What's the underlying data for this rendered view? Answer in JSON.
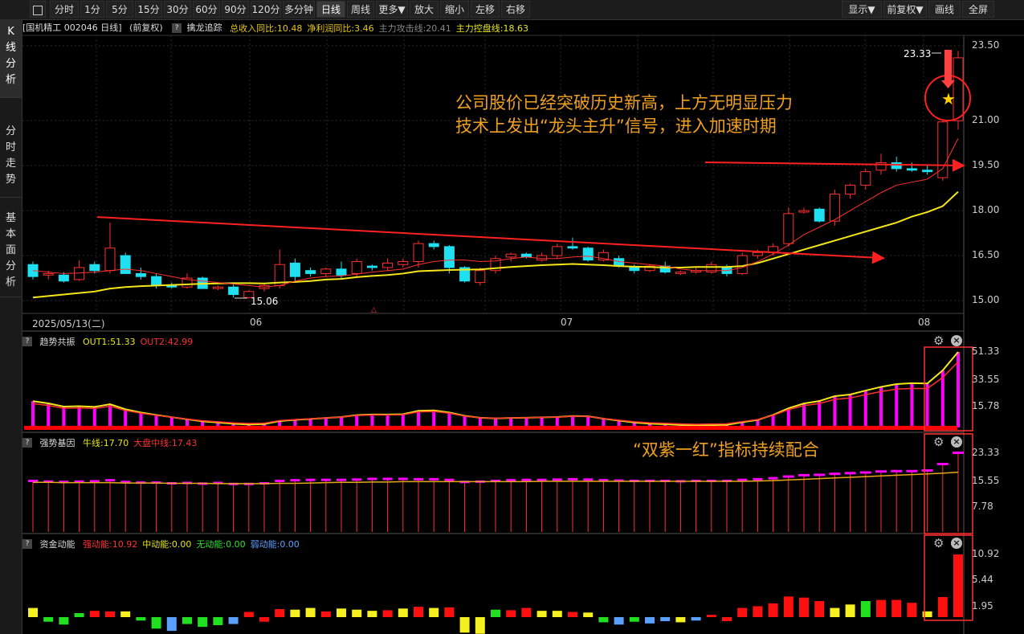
{
  "toolbar": {
    "buttons": [
      "分时",
      "1分",
      "5分",
      "15分",
      "30分",
      "60分",
      "90分",
      "120分",
      "多分钟",
      "日线",
      "周线",
      "更多▼",
      "放大",
      "缩小",
      "左移",
      "右移"
    ],
    "active": "日线",
    "right_buttons": [
      "显示▼",
      "前复权▼",
      "画线",
      "全屏"
    ]
  },
  "sidebar": {
    "items": [
      {
        "label": "K线分析",
        "active": true
      },
      {
        "label": "分时走势",
        "active": false
      },
      {
        "label": "基本面分析",
        "active": false
      }
    ]
  },
  "main_info": {
    "title": "[国机精工 002046 日线]",
    "adjust": "(前复权)",
    "indicator": "擒龙追踪",
    "fields": [
      {
        "text": "总收入同比:10.48",
        "color": "#e6c619"
      },
      {
        "text": "净利润同比:3.46",
        "color": "#e6c619"
      },
      {
        "text": "主力攻击线:20.41",
        "color": "#888888"
      },
      {
        "text": "主力控盘线:18.63",
        "color": "#e6e619"
      }
    ]
  },
  "price_axis": {
    "labels": [
      "23.50",
      "21.00",
      "19.50",
      "18.00",
      "16.50",
      "15.00"
    ],
    "ylim": [
      14.5,
      24.0
    ]
  },
  "date_axis": {
    "labels": [
      "2025/05/13(二)",
      "06",
      "07",
      "08"
    ]
  },
  "price_markers": {
    "high": "23.33",
    "low": "15.06"
  },
  "annotations": {
    "main_line1": "公司股价已经突破历史新高，上方无明显压力",
    "main_line2": "技术上发出“龙头主升”信号，进入加速时期",
    "panel3": "“双紫一红”指标持续配合"
  },
  "panel2": {
    "name": "趋势共振",
    "fields": [
      {
        "text": "OUT1:51.33",
        "color": "#e6e619"
      },
      {
        "text": "OUT2:42.99",
        "color": "#ff3030"
      }
    ],
    "axis": [
      "51.33",
      "33.55",
      "15.78"
    ]
  },
  "panel3": {
    "name": "强势基因",
    "fields": [
      {
        "text": "牛线:17.70",
        "color": "#e6e619"
      },
      {
        "text": "大盘中线:17.43",
        "color": "#ff3030"
      }
    ],
    "axis": [
      "23.33",
      "15.55",
      "7.78"
    ]
  },
  "panel4": {
    "name": "资金动能",
    "fields": [
      {
        "text": "强动能:10.92",
        "color": "#ff3030"
      },
      {
        "text": "中动能:0.00",
        "color": "#e6e619"
      },
      {
        "text": "无动能:0.00",
        "color": "#30e030"
      },
      {
        "text": "弱动能:0.00",
        "color": "#5aa0ff"
      }
    ],
    "axis": [
      "10.92",
      "5.44",
      "1.95"
    ]
  },
  "colors": {
    "up": "#ff3030",
    "down": "#1ee0f0",
    "ma_yellow": "#f5e619",
    "ma_red": "#ff3030",
    "magenta": "#ff00ff",
    "annotation": "#f0a020"
  },
  "chart_data": {
    "type": "candlestick",
    "dates": [
      "2025/05/13(二)",
      "06",
      "07",
      "08"
    ],
    "ohlc": [
      [
        16.2,
        16.3,
        15.7,
        15.8
      ],
      [
        15.85,
        16.0,
        15.7,
        15.9
      ],
      [
        15.85,
        15.95,
        15.6,
        15.65
      ],
      [
        15.7,
        16.35,
        15.65,
        16.1
      ],
      [
        16.2,
        16.3,
        15.9,
        16.0
      ],
      [
        16.0,
        17.6,
        15.9,
        16.75
      ],
      [
        16.5,
        16.6,
        15.9,
        15.9
      ],
      [
        15.9,
        16.1,
        15.7,
        15.8
      ],
      [
        15.8,
        15.9,
        15.4,
        15.5
      ],
      [
        15.5,
        15.6,
        15.4,
        15.45
      ],
      [
        15.45,
        15.9,
        15.4,
        15.75
      ],
      [
        15.75,
        15.8,
        15.4,
        15.4
      ],
      [
        15.4,
        15.5,
        15.35,
        15.45
      ],
      [
        15.45,
        15.55,
        15.1,
        15.2
      ],
      [
        15.1,
        15.35,
        15.06,
        15.3
      ],
      [
        15.4,
        15.6,
        15.3,
        15.5
      ],
      [
        15.5,
        16.7,
        15.4,
        16.2
      ],
      [
        16.25,
        16.4,
        15.6,
        15.8
      ],
      [
        16.0,
        16.1,
        15.8,
        15.9
      ],
      [
        15.9,
        16.1,
        15.8,
        16.05
      ],
      [
        16.05,
        16.3,
        15.7,
        15.85
      ],
      [
        15.9,
        16.4,
        15.8,
        16.3
      ],
      [
        16.15,
        16.2,
        16.0,
        16.1
      ],
      [
        16.1,
        16.4,
        16.0,
        16.25
      ],
      [
        16.2,
        16.4,
        16.1,
        16.3
      ],
      [
        16.3,
        17.0,
        16.1,
        16.9
      ],
      [
        16.9,
        17.0,
        16.7,
        16.8
      ],
      [
        16.8,
        16.85,
        15.9,
        16.1
      ],
      [
        16.1,
        16.15,
        15.6,
        15.65
      ],
      [
        15.6,
        16.1,
        15.5,
        16.0
      ],
      [
        16.0,
        16.5,
        15.9,
        16.4
      ],
      [
        16.45,
        16.6,
        16.3,
        16.55
      ],
      [
        16.55,
        16.6,
        16.4,
        16.45
      ],
      [
        16.35,
        16.6,
        16.3,
        16.5
      ],
      [
        16.5,
        16.9,
        16.4,
        16.8
      ],
      [
        16.8,
        17.1,
        16.7,
        16.75
      ],
      [
        16.75,
        16.8,
        16.3,
        16.35
      ],
      [
        16.35,
        16.7,
        16.3,
        16.6
      ],
      [
        16.4,
        16.5,
        16.1,
        16.15
      ],
      [
        16.1,
        16.2,
        15.9,
        16.0
      ],
      [
        16.0,
        16.2,
        15.95,
        16.15
      ],
      [
        16.15,
        16.3,
        15.9,
        15.95
      ],
      [
        15.9,
        16.0,
        15.85,
        15.95
      ],
      [
        15.95,
        16.1,
        15.9,
        16.0
      ],
      [
        15.95,
        16.3,
        15.9,
        16.2
      ],
      [
        16.1,
        16.2,
        15.8,
        15.9
      ],
      [
        15.9,
        16.6,
        15.85,
        16.5
      ],
      [
        16.5,
        16.7,
        16.4,
        16.6
      ],
      [
        16.6,
        16.9,
        16.5,
        16.8
      ],
      [
        16.9,
        18.1,
        16.8,
        17.9
      ],
      [
        17.95,
        18.1,
        17.9,
        18.0
      ],
      [
        18.05,
        18.1,
        17.6,
        17.65
      ],
      [
        17.65,
        18.7,
        17.5,
        18.55
      ],
      [
        18.55,
        18.9,
        18.4,
        18.85
      ],
      [
        18.85,
        19.4,
        18.7,
        19.3
      ],
      [
        19.35,
        19.9,
        19.2,
        19.6
      ],
      [
        19.6,
        19.8,
        19.3,
        19.4
      ],
      [
        19.4,
        19.6,
        19.3,
        19.35
      ],
      [
        19.35,
        19.5,
        19.2,
        19.3
      ],
      [
        19.1,
        21.0,
        19.0,
        20.96
      ],
      [
        21.0,
        23.33,
        20.7,
        23.1
      ]
    ],
    "ma_slow": [
      15.1,
      15.15,
      15.2,
      15.25,
      15.3,
      15.4,
      15.45,
      15.48,
      15.5,
      15.52,
      15.54,
      15.56,
      15.57,
      15.58,
      15.58,
      15.57,
      15.6,
      15.62,
      15.65,
      15.7,
      15.72,
      15.78,
      15.82,
      15.85,
      15.9,
      15.98,
      16.0,
      16.02,
      16.03,
      16.04,
      16.08,
      16.12,
      16.15,
      16.18,
      16.2,
      16.22,
      16.2,
      16.18,
      16.15,
      16.13,
      16.12,
      16.1,
      16.1,
      16.12,
      16.12,
      16.12,
      16.15,
      16.25,
      16.4,
      16.55,
      16.7,
      16.85,
      17.0,
      17.15,
      17.3,
      17.45,
      17.6,
      17.8,
      17.95,
      18.15,
      18.63
    ],
    "ma_fast": [
      16.0,
      15.95,
      15.9,
      15.92,
      15.95,
      16.0,
      16.05,
      16.0,
      15.9,
      15.8,
      15.7,
      15.65,
      15.6,
      15.55,
      15.5,
      15.45,
      15.5,
      15.65,
      15.75,
      15.8,
      15.82,
      15.88,
      15.95,
      16.0,
      16.05,
      16.2,
      16.3,
      16.35,
      16.35,
      16.3,
      16.32,
      16.4,
      16.45,
      16.4,
      16.4,
      16.45,
      16.48,
      16.4,
      16.3,
      16.25,
      16.2,
      16.15,
      16.05,
      16.0,
      16.0,
      16.0,
      16.1,
      16.3,
      16.55,
      16.85,
      17.2,
      17.45,
      17.7,
      18.0,
      18.3,
      18.6,
      18.85,
      18.95,
      19.05,
      19.4,
      20.41
    ],
    "support_line": {
      "from": [
        0,
        17.25
      ],
      "to": [
        60,
        16.95
      ]
    },
    "breakout_line": {
      "from": [
        44,
        19.55
      ],
      "to": [
        60,
        19.45
      ]
    },
    "panel2_bars": [
      17.9,
      16.4,
      14.2,
      14.5,
      14.0,
      15.8,
      12.4,
      10.2,
      8.5,
      7.0,
      5.6,
      4.2,
      3.4,
      2.5,
      2.0,
      2.3,
      4.4,
      5.2,
      5.8,
      6.5,
      7.1,
      8.4,
      8.8,
      8.8,
      9.0,
      11.3,
      11.6,
      10.2,
      7.9,
      6.6,
      6.2,
      6.5,
      6.6,
      6.9,
      7.1,
      7.8,
      7.6,
      6.0,
      4.7,
      3.4,
      2.6,
      2.2,
      1.7,
      1.4,
      1.6,
      1.8,
      3.6,
      5.2,
      8.5,
      13.1,
      16.3,
      18.0,
      21.3,
      22.4,
      25.1,
      27.6,
      29.5,
      30.1,
      29.9,
      38.8,
      51.33
    ],
    "panel3_bars": [
      15.0,
      14.8,
      14.7,
      14.8,
      14.9,
      15.2,
      14.7,
      14.5,
      14.5,
      14.3,
      14.4,
      14.2,
      14.4,
      14.1,
      14.1,
      14.3,
      15.0,
      15.2,
      15.3,
      15.3,
      15.3,
      15.4,
      15.6,
      15.6,
      15.6,
      15.5,
      15.5,
      15.3,
      14.7,
      14.8,
      15.0,
      15.2,
      15.3,
      15.3,
      15.4,
      15.5,
      15.4,
      15.2,
      15.1,
      15.0,
      15.0,
      15.0,
      14.9,
      15.0,
      15.0,
      15.0,
      15.3,
      15.5,
      15.8,
      16.3,
      16.7,
      16.8,
      17.1,
      17.3,
      17.5,
      17.8,
      17.9,
      17.9,
      18.1,
      20.0,
      23.33
    ],
    "panel3_line": [
      14.7,
      14.7,
      14.6,
      14.6,
      14.6,
      14.6,
      14.5,
      14.5,
      14.5,
      14.4,
      14.4,
      14.4,
      14.3,
      14.3,
      14.3,
      14.3,
      14.4,
      14.4,
      14.5,
      14.6,
      14.7,
      14.7,
      14.8,
      14.8,
      14.9,
      14.9,
      14.9,
      14.9,
      14.9,
      14.9,
      14.9,
      14.9,
      14.9,
      15.0,
      15.0,
      15.0,
      15.0,
      15.0,
      15.0,
      15.0,
      15.0,
      15.0,
      15.0,
      15.0,
      15.0,
      15.0,
      15.0,
      15.1,
      15.2,
      15.4,
      15.6,
      15.8,
      16.0,
      16.2,
      16.4,
      16.6,
      16.8,
      17.0,
      17.2,
      17.4,
      17.7
    ],
    "panel4_values": [
      1.6,
      0.8,
      1.3,
      0.7,
      1.1,
      1.0,
      1.0,
      0.6,
      2.0,
      2.4,
      1.2,
      1.7,
      1.4,
      1.2,
      0.9,
      0.8,
      1.4,
      1.3,
      1.6,
      1.0,
      1.5,
      1.3,
      1.1,
      1.2,
      1.5,
      1.8,
      1.6,
      1.7,
      2.7,
      2.9,
      1.3,
      1.2,
      1.6,
      1.1,
      1.1,
      0.9,
      0.8,
      0.9,
      1.3,
      0.8,
      1.1,
      0.7,
      0.9,
      0.6,
      0.4,
      0.7,
      1.6,
      1.9,
      2.4,
      3.6,
      3.4,
      2.8,
      1.6,
      2.2,
      2.8,
      3.0,
      3.0,
      2.5,
      1.0,
      3.5,
      10.92
    ],
    "panel4_colors": [
      "y",
      "g",
      "g",
      "g",
      "r",
      "r",
      "y",
      "g",
      "g",
      "b",
      "g",
      "g",
      "g",
      "b",
      "r",
      "r",
      "r",
      "y",
      "y",
      "r",
      "y",
      "y",
      "y",
      "r",
      "y",
      "r",
      "y",
      "r",
      "y",
      "y",
      "g",
      "r",
      "r",
      "y",
      "y",
      "r",
      "y",
      "g",
      "b",
      "g",
      "b",
      "b",
      "y",
      "b",
      "r",
      "r",
      "r",
      "r",
      "r",
      "r",
      "r",
      "r",
      "y",
      "y",
      "g",
      "r",
      "r",
      "r",
      "y",
      "r",
      "r"
    ],
    "panel4_signs": [
      1,
      -1,
      -1,
      1,
      1,
      1,
      1,
      -1,
      -1,
      -1,
      -1,
      -1,
      -1,
      -1,
      1,
      -1,
      1,
      1,
      1,
      1,
      1,
      1,
      1,
      1,
      1,
      1,
      1,
      1,
      -1,
      -1,
      1,
      1,
      1,
      1,
      1,
      1,
      1,
      -1,
      -1,
      -1,
      -1,
      -1,
      -1,
      -1,
      1,
      -1,
      1,
      1,
      1,
      1,
      1,
      1,
      1,
      1,
      1,
      1,
      1,
      1,
      1,
      1,
      1
    ]
  }
}
